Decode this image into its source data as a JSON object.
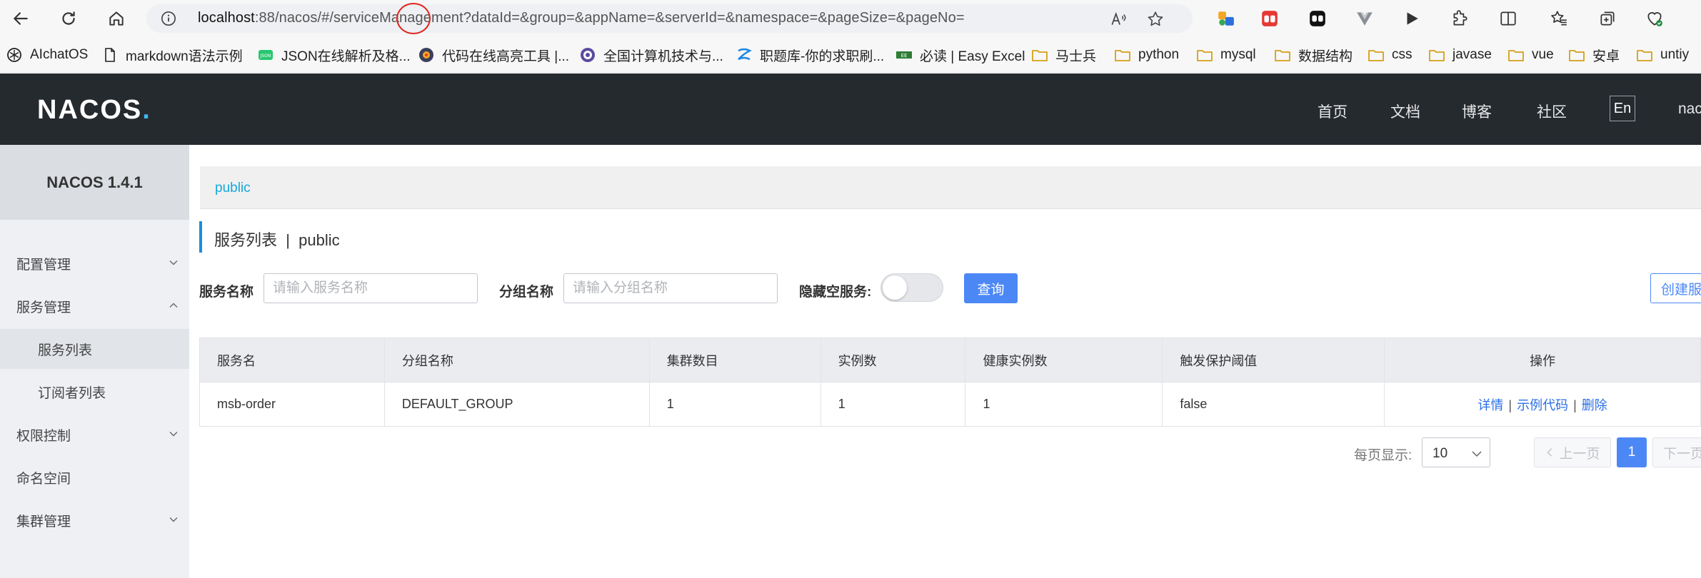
{
  "browser": {
    "url_host": "localhost",
    "url_port": ":88",
    "url_path": "/nacos/#/serviceManagement?dataId=&group=&appName=&serverId=&namespace=&pageSize=&pageNo="
  },
  "bookmarks": [
    {
      "label": "AIchatOS",
      "icon": "openai-icon"
    },
    {
      "label": "markdown语法示例",
      "icon": "document-icon"
    },
    {
      "label": "JSON在线解析及格...",
      "icon": "json-icon"
    },
    {
      "label": "代码在线高亮工具 |...",
      "icon": "code-highlight-icon"
    },
    {
      "label": "全国计算机技术与...",
      "icon": "exam-site-icon"
    },
    {
      "label": "职题库-你的求职刷...",
      "icon": "job-site-icon"
    },
    {
      "label": "必读 | Easy Excel",
      "icon": "excel-icon"
    },
    {
      "label": "马士兵",
      "icon": "folder-icon"
    },
    {
      "label": "python",
      "icon": "folder-icon"
    },
    {
      "label": "mysql",
      "icon": "folder-icon"
    },
    {
      "label": "数据结构",
      "icon": "folder-icon"
    },
    {
      "label": "css",
      "icon": "folder-icon"
    },
    {
      "label": "javase",
      "icon": "folder-icon"
    },
    {
      "label": "vue",
      "icon": "folder-icon"
    },
    {
      "label": "安卓",
      "icon": "folder-icon"
    },
    {
      "label": "untiy",
      "icon": "folder-icon"
    }
  ],
  "header": {
    "logo": "NACOS.",
    "nav": [
      "首页",
      "文档",
      "博客",
      "社区"
    ],
    "lang": "En",
    "user": "nacos"
  },
  "sidebar": {
    "title": "NACOS 1.4.1",
    "items": [
      {
        "label": "配置管理"
      },
      {
        "label": "服务管理"
      },
      {
        "label": "服务列表"
      },
      {
        "label": "订阅者列表"
      },
      {
        "label": "权限控制"
      },
      {
        "label": "命名空间"
      },
      {
        "label": "集群管理"
      }
    ]
  },
  "main": {
    "namespace_tab": "public",
    "page_title": "服务列表  |  public",
    "filters": {
      "service_name_label": "服务名称",
      "service_name_placeholder": "请输入服务名称",
      "group_name_label": "分组名称",
      "group_name_placeholder": "请输入分组名称",
      "hide_empty_label": "隐藏空服务:",
      "hide_empty_on": false,
      "query_button": "查询",
      "create_button": "创建服务"
    },
    "table": {
      "columns": [
        "服务名",
        "分组名称",
        "集群数目",
        "实例数",
        "健康实例数",
        "触发保护阈值",
        "操作"
      ],
      "rows": [
        {
          "name": "msb-order",
          "group": "DEFAULT_GROUP",
          "clusters": "1",
          "instances": "1",
          "healthy": "1",
          "threshold": "false"
        }
      ],
      "ops": [
        "详情",
        "示例代码",
        "删除"
      ],
      "op_separator": "|"
    },
    "pagination": {
      "page_size_label": "每页显示:",
      "page_size": "10",
      "prev": "上一页",
      "current": "1",
      "next": "下一页"
    }
  },
  "colors": {
    "header_bg": "#252a2f",
    "primary": "#4c88f5",
    "link": "#2b6fe5",
    "breadcrumb": "#15a8d9",
    "annotation_circle": "#e0261f"
  }
}
